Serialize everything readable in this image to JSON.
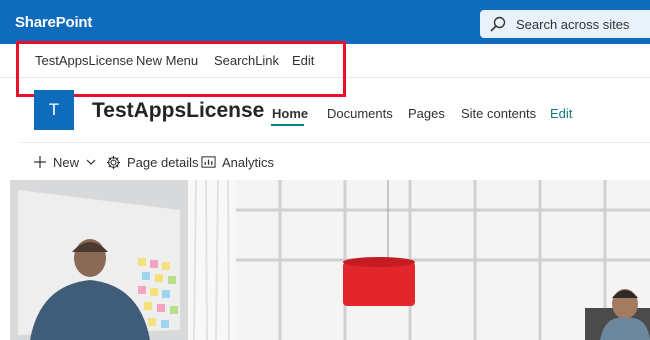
{
  "suitebar": {
    "brand": "SharePoint",
    "search_placeholder": "Search across sites"
  },
  "hubnav": {
    "items": [
      "TestAppsLicense",
      "New Menu",
      "SearchLink",
      "Edit"
    ]
  },
  "site": {
    "logo_letter": "T",
    "title": "TestAppsLicense",
    "nav": [
      "Home",
      "Documents",
      "Pages",
      "Site contents",
      "Edit"
    ],
    "active_nav": "Home"
  },
  "commandbar": {
    "new_label": "New",
    "page_details_label": "Page details",
    "analytics_label": "Analytics"
  },
  "colors": {
    "suitebar": "#0f6cbd",
    "highlight_border": "#e8102a",
    "edit_link": "#0f7b7b",
    "active_underline": "#038387"
  }
}
